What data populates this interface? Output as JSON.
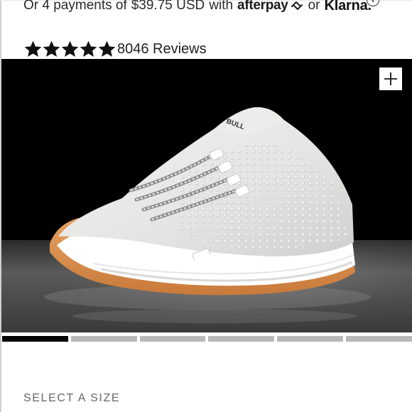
{
  "payments": {
    "prefix": "Or 4 payments of",
    "amount": "$39.75 USD",
    "with": "with",
    "afterpay": "afterpay",
    "or": "or",
    "klarna": "Klarna."
  },
  "info_icon": {
    "glyph": "i",
    "icon": "info-icon"
  },
  "rating": {
    "stars": 5,
    "reviews_text": "8046 Reviews"
  },
  "gallery": {
    "image_icon": "sneaker-photo",
    "zoom_icon": "plus-icon",
    "slide_count": 6,
    "active_slide": 1
  },
  "size_selector": {
    "label": "SELECT A SIZE"
  },
  "colors": {
    "hero_background": "#000000",
    "progress_active": "#000000",
    "progress_inactive": "#b8b8b8"
  }
}
